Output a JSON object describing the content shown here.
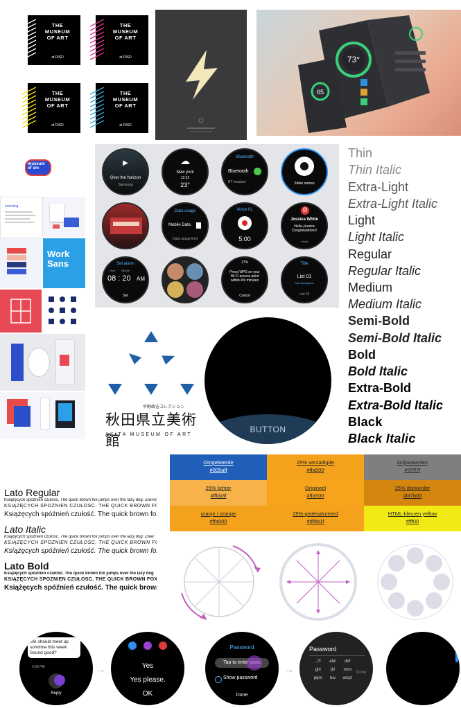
{
  "museum": {
    "title_lines": [
      "THE",
      "MUSEUM",
      "OF ART"
    ],
    "subtitle": "at RISD",
    "stripe_colors": [
      "#ffffff",
      "#e0308c",
      "#f5e11a",
      "#2aa9d8"
    ]
  },
  "poster": {
    "bg": "#3a3a3c",
    "bolt_color": "#f3e8b8"
  },
  "lowpoly": {
    "temp": "73°",
    "small": "65"
  },
  "museum_of_small": {
    "lines": [
      "museum",
      "of sm"
    ]
  },
  "brand_book": {
    "branding_label": "branding",
    "work_sans": [
      "Work",
      "Sans"
    ]
  },
  "watch_faces": {
    "music": {
      "title": "Over the horizon",
      "artist": "Samsung"
    },
    "weather": {
      "city": "New york",
      "time": "12:32",
      "temp": "23°"
    },
    "bluetooth": {
      "header": "Bluetooth",
      "item": "Bluetooth",
      "sub": "BT headset"
    },
    "slider": {
      "label": "Slider names"
    },
    "data": {
      "header": "Data usage",
      "item": "Mobile Data",
      "sub": "Data usage limit"
    },
    "voice": {
      "header": "Voice 01",
      "time": "5:00"
    },
    "contact": {
      "name": "Jessica White",
      "msg": "Hello,Jessica Congratulations!",
      "more": "+more"
    },
    "alarm": {
      "header": "Set alarm",
      "hour_label": "Hour",
      "minute_label": "Minute",
      "time": "08 : 20",
      "ampm": "AM",
      "action": "Set"
    },
    "wps": {
      "pct": "17%",
      "text": "Press WPS on your Wi-Fi access point within 4% minutes",
      "action": "Cancel"
    },
    "list": {
      "header": "Title",
      "item": "List 01",
      "sub": "Sub description",
      "foot": "List 02"
    }
  },
  "akita": {
    "jp_small": "平野政吉コレクション",
    "jp_main": "秋田県立美術館",
    "en": "AKITA MUSEUM OF ART",
    "tri_color": "#1f5fa8"
  },
  "big_watch": {
    "button": "BUTTON",
    "accent": "#1f3b55"
  },
  "font_weights": [
    {
      "label": "Thin",
      "weight": 100,
      "italic": false
    },
    {
      "label": "Thin Italic",
      "weight": 100,
      "italic": true
    },
    {
      "label": "Extra-Light",
      "weight": 200,
      "italic": false
    },
    {
      "label": "Extra-Light Italic",
      "weight": 200,
      "italic": true
    },
    {
      "label": "Light",
      "weight": 300,
      "italic": false
    },
    {
      "label": "Light Italic",
      "weight": 300,
      "italic": true
    },
    {
      "label": "Regular",
      "weight": 400,
      "italic": false
    },
    {
      "label": "Regular Italic",
      "weight": 400,
      "italic": true
    },
    {
      "label": "Medium",
      "weight": 500,
      "italic": false
    },
    {
      "label": "Medium Italic",
      "weight": 500,
      "italic": true
    },
    {
      "label": "Semi-Bold",
      "weight": 600,
      "italic": false
    },
    {
      "label": "Semi-Bold Italic",
      "weight": 600,
      "italic": true
    },
    {
      "label": "Bold",
      "weight": 700,
      "italic": false
    },
    {
      "label": "Bold Italic",
      "weight": 700,
      "italic": true
    },
    {
      "label": "Extra-Bold",
      "weight": 800,
      "italic": false
    },
    {
      "label": "Extra-Bold Italic",
      "weight": 800,
      "italic": true
    },
    {
      "label": "Black",
      "weight": 900,
      "italic": false
    },
    {
      "label": "Black Italic",
      "weight": 900,
      "italic": true
    }
  ],
  "lato": [
    {
      "heading": "Lato Regular",
      "style": "regular",
      "small": "Książęcych spóźnień czułość. The quick brown fox jumps over the lazy dog. Zwinny",
      "caps": "KSIĄŻĘCYCH SPÓŹNIEŃ CZUŁOŚĆ. THE QUICK BROWN FOX JUMPS OVER",
      "large": "Książęcych spóźnień czułość. The quick brown fox"
    },
    {
      "heading": "Lato Italic",
      "style": "italic",
      "small": "Książęcych spóźnień czułość. The quick brown fox jumps over the lazy dog. Zwei",
      "caps": "KSIĄŻĘCYCH SPÓŹNIEŃ CZUŁOŚĆ. THE QUICK BROWN FOX JUMPS OVER",
      "large": "Książęcych spóźnień czułość. The quick brown fox"
    },
    {
      "heading": "Lato Bold",
      "style": "bold",
      "small": "Książęcych spóźnień czułość. The quick brown fox jumps over the lazy dog",
      "caps": "KSIĄŻĘCYCH SPÓŹNIEŃ CZUŁOŚĆ. THE QUICK BROWN FOX JUMPS OVER",
      "large": "Książęcych spóźnień czułość. The quick brown"
    }
  ],
  "swatches": [
    {
      "label": "Omgekeerde",
      "hex": "#005aff",
      "bg": "#1f5fba",
      "fg": "#ffffff"
    },
    {
      "label": "25% verzadigde",
      "hex": "#ffa500",
      "bg": "#f4a21c",
      "fg": "#222222"
    },
    {
      "label": "Grijswaarden",
      "hex": "#7f7f7f",
      "bg": "#7f7f7f",
      "fg": "#222222"
    },
    {
      "label": "25% lichter",
      "hex": "#ffbb3f",
      "bg": "#f7b34a",
      "fg": "#222222"
    },
    {
      "label": "Origineel",
      "hex": "#ffa500",
      "bg": "#f7a41c",
      "fg": "#222222"
    },
    {
      "label": "25% donkerder",
      "hex": "#bf7b00",
      "bg": "#d4860f",
      "fg": "#222222"
    },
    {
      "label": "oranje / orange",
      "hex": "#ffa500",
      "bg": "#f4a21c",
      "fg": "#222222"
    },
    {
      "label": "25% gedesatureerd",
      "hex": "#df9b1f",
      "bg": "#f4a21c",
      "fg": "#222222"
    },
    {
      "label": "HTML-kleuren  yellow",
      "hex": "#fff00",
      "bg": "#f2ea14",
      "fg": "#222222"
    }
  ],
  "circles": {
    "arc_color": "#c060c0",
    "spoke_color": "#cfcfd8",
    "dot_color": "#dcdde6"
  },
  "flow": {
    "msg": "We should meet up somtime this week Sound good?",
    "msg_time": "4:35 PM",
    "reply": "Reply",
    "opts": [
      "Yes",
      "Yes please.",
      "OK"
    ],
    "pwd_title": "Password",
    "pwd_hint": "Tap to enter pass",
    "pwd_show": "Show password",
    "pwd_done": "Done",
    "kb_title": "Password",
    "kb_keys": [
      ".,?!",
      "abc",
      "def",
      "ghi",
      "jkl",
      "mno",
      "pqrs",
      "tuv",
      "wxyz"
    ],
    "kb_done": "Done"
  }
}
